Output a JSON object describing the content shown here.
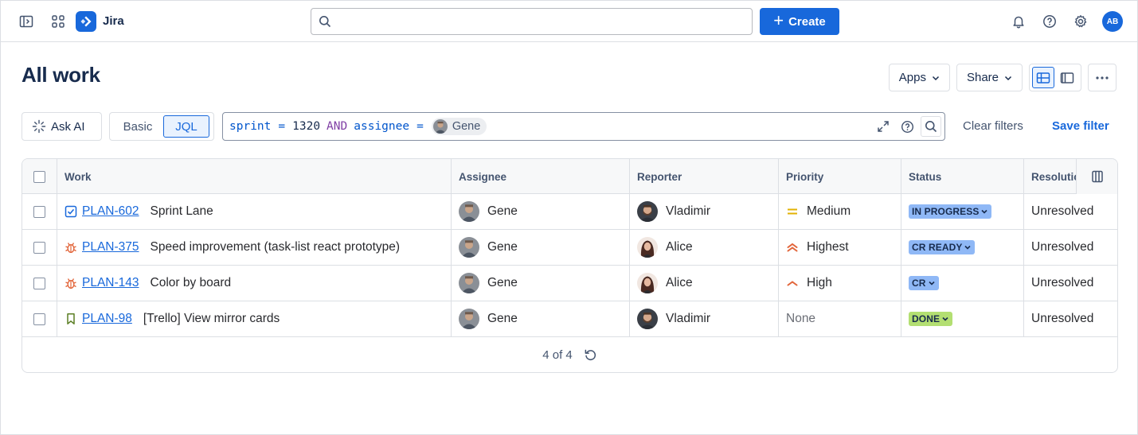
{
  "topbar": {
    "app_name": "Jira",
    "search_placeholder": "",
    "create_label": "Create",
    "user_initials": "AB"
  },
  "page": {
    "title": "All work",
    "apps_label": "Apps",
    "share_label": "Share"
  },
  "filters": {
    "ask_ai_label": "Ask AI",
    "mode_basic": "Basic",
    "mode_jql": "JQL",
    "jql": {
      "field1": "sprint",
      "op1": "=",
      "value1": "1320",
      "keyword": "AND",
      "field2": "assignee",
      "op2": "=",
      "chip": "Gene"
    },
    "clear_label": "Clear filters",
    "save_label": "Save filter"
  },
  "table": {
    "columns": [
      "Work",
      "Assignee",
      "Reporter",
      "Priority",
      "Status",
      "Resolution"
    ],
    "rows": [
      {
        "type": "task",
        "key": "PLAN-602",
        "summary": "Sprint Lane",
        "assignee": "Gene",
        "reporter": "Vladimir",
        "priority": "Medium",
        "priority_icon": "medium-priority-icon",
        "status": "IN PROGRESS",
        "status_color": "#8fb8f6",
        "resolution": "Unresolved"
      },
      {
        "type": "bug",
        "key": "PLAN-375",
        "summary": "Speed improvement (task-list react prototype)",
        "assignee": "Gene",
        "reporter": "Alice",
        "priority": "Highest",
        "priority_icon": "highest-priority-icon",
        "status": "CR READY",
        "status_color": "#8fb8f6",
        "resolution": "Unresolved"
      },
      {
        "type": "bug",
        "key": "PLAN-143",
        "summary": "Color by board",
        "assignee": "Gene",
        "reporter": "Alice",
        "priority": "High",
        "priority_icon": "high-priority-icon",
        "status": "CR",
        "status_color": "#8fb8f6",
        "resolution": "Unresolved"
      },
      {
        "type": "story",
        "key": "PLAN-98",
        "summary": "[Trello] View mirror cards",
        "assignee": "Gene",
        "reporter": "Vladimir",
        "priority": "None",
        "priority_icon": "",
        "status": "DONE",
        "status_color": "#b3df72",
        "resolution": "Unresolved"
      }
    ],
    "footer": "4 of 4"
  },
  "colors": {
    "brand": "#1868db",
    "border": "#dcdfe4",
    "priority_orange": "#e2653a",
    "priority_yellow": "#e2b203"
  }
}
